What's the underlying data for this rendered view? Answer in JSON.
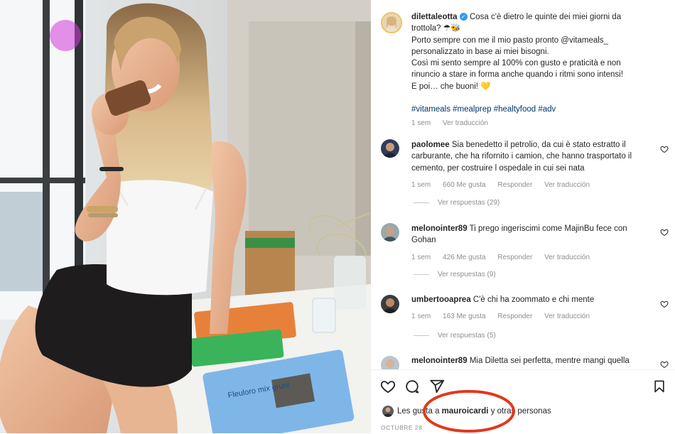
{
  "caption": {
    "username": "dilettaleotta",
    "lines": [
      "Cosa c'è dietro le quinte dei miei giorni da",
      "trottola? ☂🐝",
      "Porto sempre con me il mio pasto pronto @vitameals_",
      "personalizzato in base ai miei bisogni.",
      "Così mi sento sempre al 100% con gusto e praticità e non",
      "rinuncio a stare in forma anche quando i ritmi sono intensi!",
      "E poi… che buoni! 💛"
    ],
    "hashtags": "#vitameals #mealprep #healtyfood #adv",
    "time": "1 sem",
    "translate": "Ver traducción"
  },
  "comments": [
    {
      "username": "paolomee",
      "lines": [
        "Sia benedetto il petrolio, da cui è stato estratto il",
        "carburante, che ha rifornito i camion, che hanno trasportato il",
        "cemento, per costruire l ospedale in cui sei nata"
      ],
      "time": "1 sem",
      "likes": "660 Me gusta",
      "reply": "Responder",
      "translate": "Ver traducción",
      "replies": "Ver respuestas (29)"
    },
    {
      "username": "melonointer89",
      "lines": [
        "Ti prego ingeriscimi come MajinBu fece con",
        "Gohan"
      ],
      "time": "1 sem",
      "likes": "426 Me gusta",
      "reply": "Responder",
      "translate": "Ver traducción",
      "replies": "Ver respuestas (9)"
    },
    {
      "username": "umbertooaprea",
      "lines": [
        "C'è chi ha zoommato e chi mente"
      ],
      "time": "1 sem",
      "likes": "163 Me gusta",
      "reply": "Responder",
      "translate": "Ver traducción",
      "replies": "Ver respuestas (5)"
    },
    {
      "username": "melonointer89",
      "lines": [
        "Mia Diletta sei perfetta, mentre mangi quella"
      ]
    }
  ],
  "likes_bar": {
    "prefix": "Les gusta a",
    "user": "mauroicardi",
    "suffix": "y otras personas"
  },
  "date": "OCTUBRE 28",
  "photo_package_text": "Fleuloro mix grüni",
  "icons": {
    "like": "heart-icon",
    "comment": "comment-icon",
    "share": "send-icon",
    "save": "bookmark-icon",
    "comment_like": "small-heart-icon"
  },
  "colors": {
    "annotation_circle": "#e0391c",
    "verified": "#3897f0",
    "link": "#00376b",
    "muted": "#8e8e8e"
  }
}
